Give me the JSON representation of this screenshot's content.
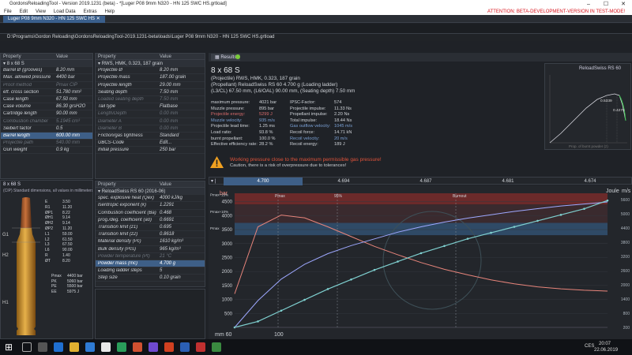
{
  "app": {
    "title": "GordonsReloadingTool - Version 2019.1231 (beta) - *[Luger P08 9mm N320 - HN 125 SWC HS.grtload]",
    "menu": [
      "File",
      "Edit",
      "View",
      "Load Data",
      "Extras",
      "Help"
    ],
    "warning": "ATTENTION: BETA-DEVELOPMENT-VERSION IN TEST-MODE!",
    "tab": "Luger P08 9mm N320 - HN 125 SWC HS",
    "path": "D:\\Programs\\Gordon Reloading\\GordonsReloadingTool-2019.1231-beta\\loads\\Luger P08 9mm N320 - HN 125 SWC HS.grtload"
  },
  "colors": {
    "accent": "#3e5f87",
    "warn": "#e0533a",
    "red_band": "#7a2e2e",
    "pressure": "#e8857b",
    "velocity": "#9ea8ff",
    "energy": "#7fd0d0"
  },
  "panel_weapon": {
    "headers": [
      "Property",
      "Value"
    ],
    "group": "8 x 68 S",
    "rows": [
      {
        "n": "Barrel Ø (grooves)",
        "v": "8.20 mm"
      },
      {
        "n": "Max. allowed pressure",
        "v": "4400 bar"
      },
      {
        "n": "Proof method",
        "v": "Pmax CIP",
        "dim": true
      },
      {
        "n": "eff. cross section",
        "v": "51.780 mm²",
        "bar": true
      },
      {
        "n": "Case length",
        "v": "67.50 mm"
      },
      {
        "n": "Case volume",
        "v": "86.30 grsH2O"
      },
      {
        "n": "Cartridge length",
        "v": "90.00 mm"
      },
      {
        "n": "Combustion chamber",
        "v": "5.1945 cm³",
        "dim": true
      },
      {
        "n": "Seibert factor",
        "v": "0.5"
      },
      {
        "n": "Barrel length",
        "v": "600.00 mm",
        "sel": true
      },
      {
        "n": "Projectile path",
        "v": "540.00 mm",
        "dim": true
      },
      {
        "n": "Gun weight",
        "v": "0.9 kg"
      }
    ]
  },
  "panel_projectile": {
    "headers": [
      "Property",
      "Value"
    ],
    "group": "RWS, HMK, 0.323, 187 grain",
    "rows": [
      {
        "n": "Projectile Ø",
        "v": "8.20 mm"
      },
      {
        "n": "Projectile mass",
        "v": "187.00 grain"
      },
      {
        "n": "Projectile length",
        "v": "29.00 mm"
      },
      {
        "n": "Seating depth",
        "v": "7.50 mm"
      },
      {
        "n": "Loaded seating depth",
        "v": "7.50 mm",
        "dim": true
      },
      {
        "n": "Tail type",
        "v": "Flatbase"
      },
      {
        "n": "Length/Depth",
        "v": "0.00 mm",
        "dim": true
      },
      {
        "n": "Diameter A",
        "v": "0.00 mm",
        "dim": true
      },
      {
        "n": "Diameter B",
        "v": "0.00 mm",
        "dim": true
      },
      {
        "n": "Friction/gas tightness",
        "v": "Standard"
      },
      {
        "n": "UBCS-Code",
        "v": "Edit..."
      },
      {
        "n": "Initial pressure",
        "v": "250 bar"
      }
    ]
  },
  "panel_powder": {
    "headers": [
      "Property",
      "Value"
    ],
    "group": "ReloadSwiss RS 60 (2016-06)",
    "rows": [
      {
        "n": "spec. explosive heat (Qex)",
        "v": "4000 kJ/kg"
      },
      {
        "n": "Isentropic exponent (k)",
        "v": "1.2291"
      },
      {
        "n": "Combustion coefficient (Ba)",
        "v": "0.468"
      },
      {
        "n": "prog./deg. coefficient (a0)",
        "v": "0.6691"
      },
      {
        "n": "Transition limit (z1)",
        "v": "0.695"
      },
      {
        "n": "Transition limit (z2)",
        "v": "0.8618"
      },
      {
        "n": "Material density (Pc)",
        "v": "1610 kg/m³"
      },
      {
        "n": "Bulk density (Pcs)",
        "v": "965 kg/m³"
      },
      {
        "n": "Powder temperature (Pt)",
        "v": "21 °C",
        "dim": true
      },
      {
        "n": "Powder mass (mc)",
        "v": "4.700 g",
        "sel": true
      },
      {
        "n": "Loading ladder steps",
        "v": "5"
      },
      {
        "n": "Step size",
        "v": "0.10 grain"
      }
    ]
  },
  "bullet": {
    "title": "8 x 68 S",
    "subtitle": "(CIP) Standard dimensions, all values in millimeters",
    "dims": [
      {
        "k": "E",
        "v": "3.50"
      },
      {
        "k": "R1",
        "v": "11.20"
      },
      {
        "k": "ØP1",
        "v": "8.22"
      },
      {
        "k": "ØH1",
        "v": "9.14"
      },
      {
        "k": "ØH2",
        "v": "9.14"
      },
      {
        "k": "ØP2",
        "v": "11.20"
      },
      {
        "k": "L1",
        "v": "59.00"
      },
      {
        "k": "L2",
        "v": "61.50"
      },
      {
        "k": "L3",
        "v": "67.50"
      },
      {
        "k": "L6",
        "v": "90.00"
      },
      {
        "k": "R",
        "v": "1.40"
      },
      {
        "k": "ØT",
        "v": "8.20"
      }
    ],
    "pmax": [
      {
        "k": "Pmax",
        "v": "4400 bar"
      },
      {
        "k": "PK",
        "v": "5060 bar"
      },
      {
        "k": "PE",
        "v": "5500 bar"
      },
      {
        "k": "EE",
        "v": "5975 J"
      }
    ]
  },
  "results": {
    "tab": "Results",
    "title": "8 x 68 S",
    "line1": "(Projectile) RWS, HMK, 0.323, 187 grain",
    "line2": "(Propellant) ReloadSwiss RS 60 4.700 g (Loading ladder)",
    "line3": "(L3/CL) 67.50 mm, (L6/OAL) 90.00 mm, (Seating depth) 7.50 mm",
    "left": [
      {
        "k": "maximum pressure:",
        "v": "4021 bar"
      },
      {
        "k": "Muzzle pressure:",
        "v": "895 bar"
      },
      {
        "k": "Projectile energy:",
        "v": "5299 J"
      },
      {
        "k": "Muzzle velocity:",
        "v": "935 m/s"
      },
      {
        "k": "Projectile lead time:",
        "v": "1.25 ms"
      },
      {
        "k": "Load ratio:",
        "v": "93.8 %"
      },
      {
        "k": "burnt propellant:",
        "v": "100.0 %"
      },
      {
        "k": "Effective efficiency rate:",
        "v": "28.2 %"
      }
    ],
    "right": [
      {
        "k": "IPSC-Factor:",
        "v": "574"
      },
      {
        "k": "Projectile impulse:",
        "v": "11.33 Ns"
      },
      {
        "k": "Propellant impulse:",
        "v": "2.20 Ns"
      },
      {
        "k": "Total impulse:",
        "v": "18.44 Ns"
      },
      {
        "k": "Gas outflow velocity:",
        "v": "1045 m/s"
      },
      {
        "k": "Recoil force:",
        "v": "14.71 kN"
      },
      {
        "k": "Recoil velocity:",
        "v": "20 m/s"
      },
      {
        "k": "Recoil energy:",
        "v": "189 J"
      }
    ],
    "warning_title": "Working pressure close to the maximum permissible gas pressure!",
    "warning_sub": "Caution, there is a risk of overpressure due to tolerances!",
    "mini_title": "ReloadSwiss RS 60",
    "mini_vals": [
      "0.5339",
      "0.4275"
    ],
    "mini_xlabel": "Prop. of burnt powder (z)"
  },
  "ladder": [
    "4.700",
    "4.694",
    "4.687",
    "4.681",
    "4.674"
  ],
  "chart_data": {
    "type": "line",
    "y_left_unit": "bar",
    "y_right_units": [
      "Joule",
      "m/s"
    ],
    "x_ticks": [
      "mm 60",
      "100"
    ],
    "left_ticks": [
      "4500",
      "4000",
      "3500",
      "3000",
      "2500",
      "2000",
      "1500",
      "1000",
      "500"
    ],
    "right_ticks": [
      "5600",
      "5000",
      "4400",
      "3800",
      "3200",
      "2600",
      "2000",
      "1400",
      "800",
      "200"
    ],
    "markers": [
      "Pmax",
      "95%",
      "Burnout"
    ],
    "bands": [
      "Pmax+15%",
      "Pmax+10%",
      "Pmax"
    ],
    "series": [
      {
        "name": "Pressure",
        "values": [
          1200,
          3600,
          4021,
          3920,
          3600,
          3250,
          2900,
          2600,
          2320,
          2080,
          1880,
          1700,
          1560,
          1450,
          1380,
          1330,
          1300
        ]
      },
      {
        "name": "Velocity",
        "values": [
          0,
          200,
          360,
          470,
          550,
          610,
          660,
          710,
          750,
          785,
          815,
          840,
          865,
          885,
          905,
          920,
          935
        ]
      },
      {
        "name": "Energy",
        "values": [
          0,
          250,
          700,
          1150,
          1600,
          2000,
          2400,
          2750,
          3100,
          3400,
          3700,
          3950,
          4200,
          4450,
          4700,
          4950,
          5299
        ]
      }
    ]
  },
  "taskbar": {
    "time": "20:07",
    "date": "22.06.2019",
    "lang": "CES"
  }
}
